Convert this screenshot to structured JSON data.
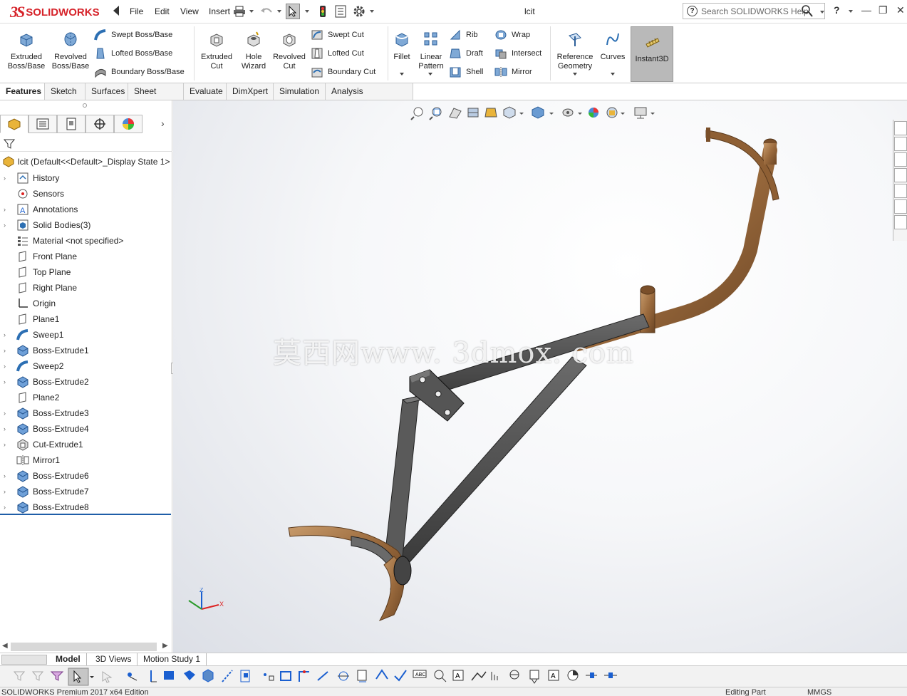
{
  "app": {
    "brand": "SOLIDWORKS",
    "doc_title": "lcit",
    "search_placeholder": "Search SOLIDWORKS Help"
  },
  "menu": [
    "File",
    "Edit",
    "View",
    "Insert"
  ],
  "ribbon": {
    "extruded_boss": "Extruded\nBoss/Base",
    "revolved_boss": "Revolved\nBoss/Base",
    "swept_boss": "Swept Boss/Base",
    "lofted_boss": "Lofted Boss/Base",
    "boundary_boss": "Boundary Boss/Base",
    "extruded_cut": "Extruded\nCut",
    "hole_wizard": "Hole\nWizard",
    "revolved_cut": "Revolved\nCut",
    "swept_cut": "Swept Cut",
    "lofted_cut": "Lofted Cut",
    "boundary_cut": "Boundary Cut",
    "fillet": "Fillet",
    "linear_pattern": "Linear\nPattern",
    "rib": "Rib",
    "draft": "Draft",
    "shell": "Shell",
    "wrap": "Wrap",
    "intersect": "Intersect",
    "mirror": "Mirror",
    "reference_geometry": "Reference\nGeometry",
    "curves": "Curves",
    "instant3d": "Instant3D"
  },
  "tabs": [
    "Features",
    "Sketch",
    "Surfaces",
    "Sheet Metal",
    "Evaluate",
    "DimXpert",
    "Simulation",
    "Analysis Preparation"
  ],
  "tree": {
    "root": "lcit  (Default<<Default>_Display State 1>",
    "items": [
      {
        "label": "History",
        "expandable": true,
        "icon": "history-icon"
      },
      {
        "label": "Sensors",
        "expandable": false,
        "icon": "sensor-icon"
      },
      {
        "label": "Annotations",
        "expandable": true,
        "icon": "annotations-icon"
      },
      {
        "label": "Solid Bodies(3)",
        "expandable": true,
        "icon": "solid-bodies-icon"
      },
      {
        "label": "Material <not specified>",
        "expandable": false,
        "icon": "material-icon"
      },
      {
        "label": "Front Plane",
        "expandable": false,
        "icon": "plane-icon"
      },
      {
        "label": "Top Plane",
        "expandable": false,
        "icon": "plane-icon"
      },
      {
        "label": "Right Plane",
        "expandable": false,
        "icon": "plane-icon"
      },
      {
        "label": "Origin",
        "expandable": false,
        "icon": "origin-icon"
      },
      {
        "label": "Plane1",
        "expandable": false,
        "icon": "plane-icon"
      },
      {
        "label": "Sweep1",
        "expandable": true,
        "icon": "sweep-icon"
      },
      {
        "label": "Boss-Extrude1",
        "expandable": true,
        "icon": "boss-extrude-icon"
      },
      {
        "label": "Sweep2",
        "expandable": true,
        "icon": "sweep-icon"
      },
      {
        "label": "Boss-Extrude2",
        "expandable": true,
        "icon": "boss-extrude-icon"
      },
      {
        "label": "Plane2",
        "expandable": false,
        "icon": "plane-icon"
      },
      {
        "label": "Boss-Extrude3",
        "expandable": true,
        "icon": "boss-extrude-icon"
      },
      {
        "label": "Boss-Extrude4",
        "expandable": true,
        "icon": "boss-extrude-icon"
      },
      {
        "label": "Cut-Extrude1",
        "expandable": true,
        "icon": "cut-extrude-icon"
      },
      {
        "label": "Mirror1",
        "expandable": false,
        "icon": "mirror-icon"
      },
      {
        "label": "Boss-Extrude6",
        "expandable": true,
        "icon": "boss-extrude-icon"
      },
      {
        "label": "Boss-Extrude7",
        "expandable": true,
        "icon": "boss-extrude-icon"
      },
      {
        "label": "Boss-Extrude8",
        "expandable": true,
        "icon": "boss-extrude-icon"
      }
    ]
  },
  "viewport": {
    "watermark": "莫西网www. 3dmox. com"
  },
  "bottom_tabs": [
    "Model",
    "3D Views",
    "Motion Study 1"
  ],
  "status": {
    "edition": "SOLIDWORKS Premium 2017 x64 Edition",
    "mode": "Editing Part",
    "units": "MMGS"
  },
  "colors": {
    "brand_red": "#d6232a",
    "copper": "#9a6a3d",
    "steel": "#4d4d4d",
    "tree_icon_blue": "#2c6fb3"
  }
}
